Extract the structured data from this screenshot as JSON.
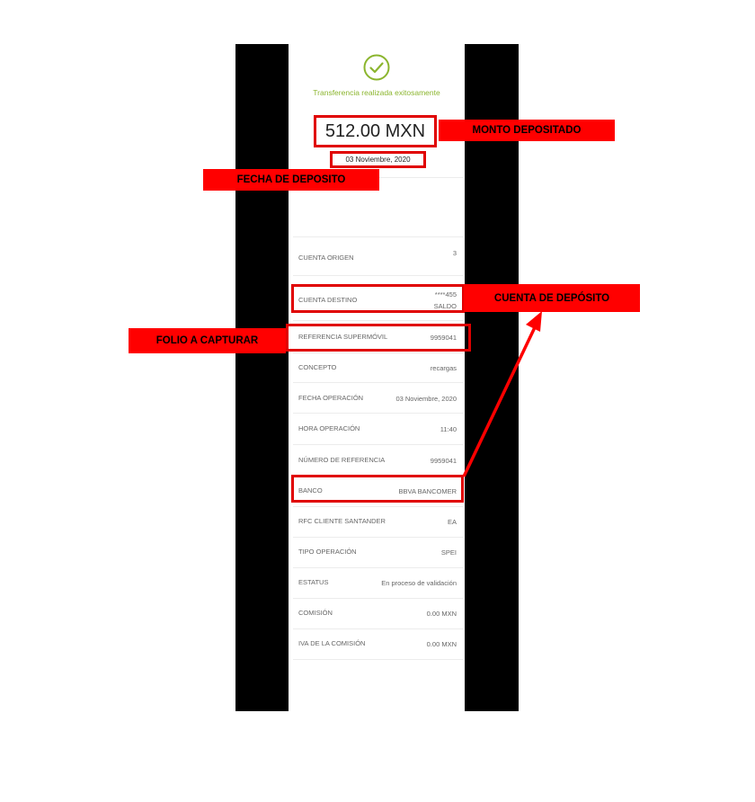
{
  "header": {
    "status_text": "Transferencia realizada exitosamente",
    "amount": "512.00 MXN",
    "date": "03 Noviembre, 2020"
  },
  "rows": [
    {
      "label": "CUENTA ORIGEN",
      "value": "3"
    },
    {
      "label": "CUENTA DESTINO",
      "value": "****455",
      "value2": "SALDO"
    },
    {
      "label": "REFERENCIA SUPERMÓVIL",
      "value": "9959041"
    },
    {
      "label": "CONCEPTO",
      "value": "recargas"
    },
    {
      "label": "FECHA OPERACIÓN",
      "value": "03 Noviembre, 2020"
    },
    {
      "label": "HORA OPERACIÓN",
      "value": "11:40"
    },
    {
      "label": "NÚMERO DE REFERENCIA",
      "value": "9959041"
    },
    {
      "label": "BANCO",
      "value": "BBVA BANCOMER"
    },
    {
      "label": "RFC CLIENTE SANTANDER",
      "value": "EA"
    },
    {
      "label": "TIPO OPERACIÓN",
      "value": "SPEI"
    },
    {
      "label": "ESTATUS",
      "value": "En proceso de validación"
    },
    {
      "label": "COMISIÓN",
      "value": "0.00 MXN"
    },
    {
      "label": "IVA DE LA COMISIÓN",
      "value": "0.00 MXN"
    }
  ],
  "annotations": {
    "monto": "MONTO DEPOSITADO",
    "fecha": "FECHA DE DEPOSITO",
    "cuenta": "CUENTA DE DEPÓSITO",
    "folio": "FOLIO A CAPTURAR"
  },
  "colors": {
    "success_green": "#8bb52e",
    "highlight_red": "#ff0000",
    "bars": "#000000"
  },
  "icons": {
    "success": "check-circle-icon"
  }
}
